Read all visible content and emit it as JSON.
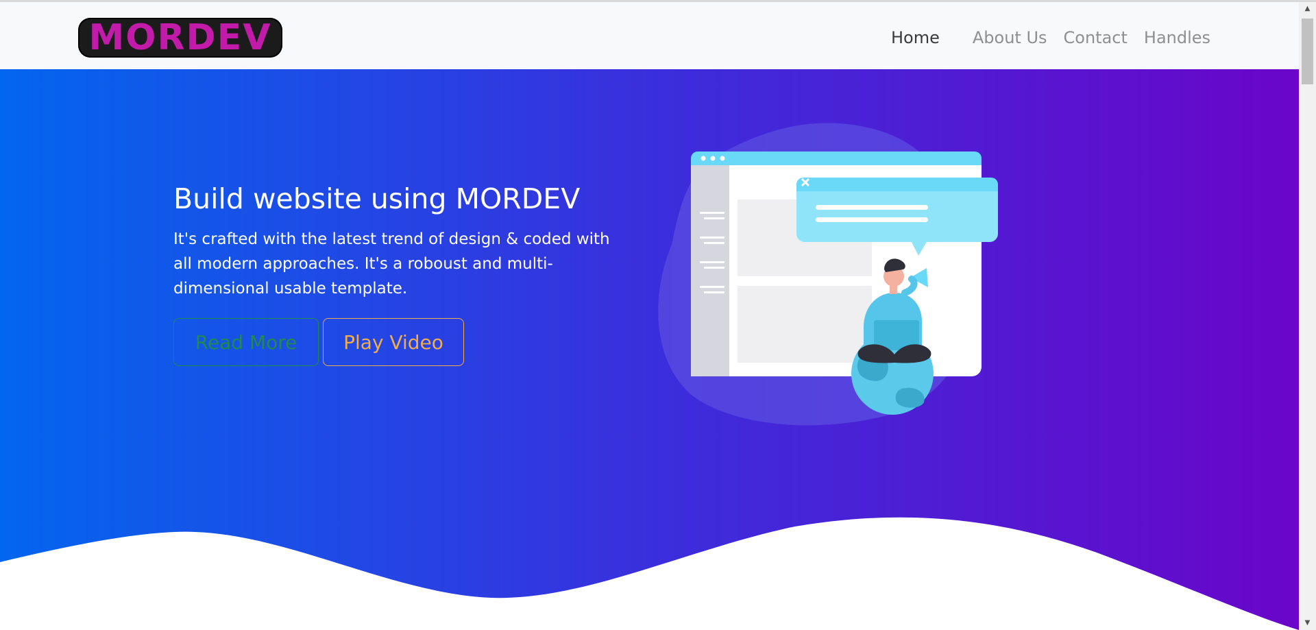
{
  "navbar": {
    "logo_text": "MORDEV",
    "links": [
      {
        "label": "Home",
        "active": true
      },
      {
        "label": "About Us",
        "active": false
      },
      {
        "label": "Contact",
        "active": false
      },
      {
        "label": "Handles",
        "active": false
      }
    ]
  },
  "hero": {
    "title": "Build website using MORDEV",
    "description": "It's crafted with the latest trend of design & coded with all modern approaches. It's a roboust and multi-dimensional usable template.",
    "read_more_label": "Read More",
    "play_video_label": "Play Video"
  },
  "colors": {
    "gradient_start": "#0366ee",
    "gradient_end": "#6a05c9",
    "logo_magenta": "#c21aa9",
    "read_more_green": "#1f8a4c",
    "play_video_orange": "#f0ad4e"
  },
  "icons": {
    "scroll_up": "chevron-up-icon",
    "scroll_down": "chevron-down-icon",
    "illustration": "person-with-megaphone-on-globe"
  }
}
